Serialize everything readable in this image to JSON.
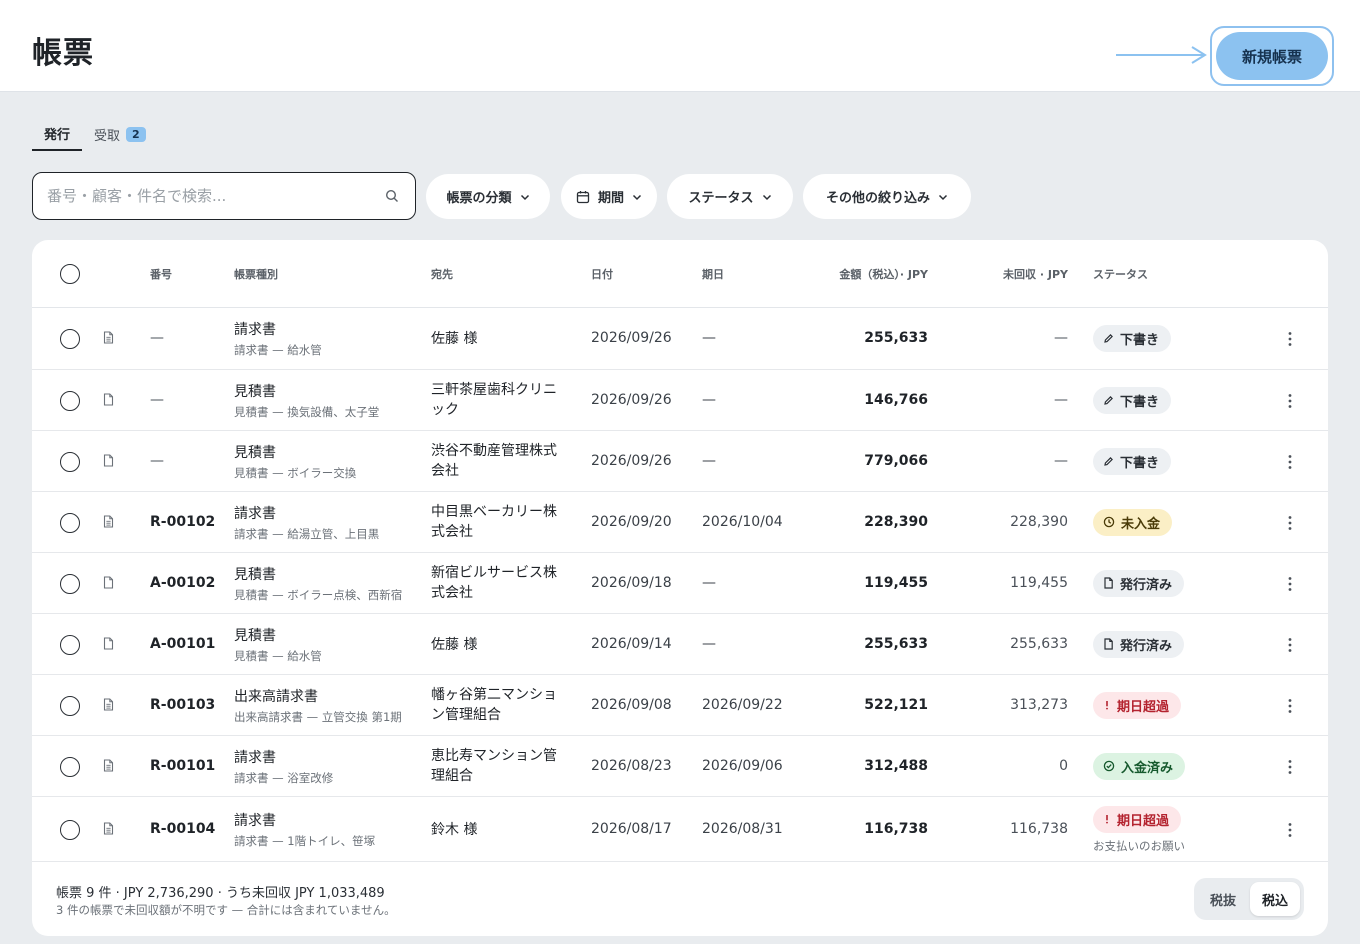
{
  "header": {
    "title": "帳票",
    "new_button": "新規帳票"
  },
  "tabs": [
    {
      "label": "発行",
      "active": true
    },
    {
      "label": "受取",
      "badge": "2"
    }
  ],
  "search": {
    "placeholder": "番号・顧客・件名で検索...",
    "value": ""
  },
  "filters": [
    {
      "label": "帳票の分類",
      "icon": "chevron-down-icon"
    },
    {
      "label": "期間",
      "icon": "calendar-icon"
    },
    {
      "label": "ステータス",
      "icon": "chevron-down-icon"
    },
    {
      "label": "その他の絞り込み",
      "icon": "chevron-down-icon"
    }
  ],
  "table": {
    "columns": [
      "番号",
      "帳票種別",
      "宛先",
      "日付",
      "期日",
      "金額（税込）· JPY",
      "未回収 · JPY",
      "ステータス"
    ],
    "rows": [
      {
        "number": "—",
        "type": "請求書",
        "subtitle": "請求書 — 給水管",
        "recipient": "佐藤 様",
        "date": "2026/09/26",
        "due": "—",
        "amount": "255,633",
        "unpaid": "—",
        "status": "下書き",
        "status_kind": "draft"
      },
      {
        "number": "—",
        "type": "見積書",
        "subtitle": "見積書 — 換気設備、太子堂",
        "recipient": "三軒茶屋歯科クリニック",
        "date": "2026/09/26",
        "due": "—",
        "amount": "146,766",
        "unpaid": "—",
        "status": "下書き",
        "status_kind": "draft"
      },
      {
        "number": "—",
        "type": "見積書",
        "subtitle": "見積書 — ボイラー交換",
        "recipient": "渋谷不動産管理株式会社",
        "date": "2026/09/26",
        "due": "—",
        "amount": "779,066",
        "unpaid": "—",
        "status": "下書き",
        "status_kind": "draft"
      },
      {
        "number": "R-00102",
        "type": "請求書",
        "subtitle": "請求書 — 給湯立管、上目黒",
        "recipient": "中目黒ベーカリー株式会社",
        "date": "2026/09/20",
        "due": "2026/10/04",
        "amount": "228,390",
        "unpaid": "228,390",
        "status": "未入金",
        "status_kind": "unpaid"
      },
      {
        "number": "A-00102",
        "type": "見積書",
        "subtitle": "見積書 — ボイラー点検、西新宿",
        "recipient": "新宿ビルサービス株式会社",
        "date": "2026/09/18",
        "due": "—",
        "amount": "119,455",
        "unpaid": "119,455",
        "status": "発行済み",
        "status_kind": "issued"
      },
      {
        "number": "A-00101",
        "type": "見積書",
        "subtitle": "見積書 — 給水管",
        "recipient": "佐藤 様",
        "date": "2026/09/14",
        "due": "—",
        "amount": "255,633",
        "unpaid": "255,633",
        "status": "発行済み",
        "status_kind": "issued"
      },
      {
        "number": "R-00103",
        "type": "出来高請求書",
        "subtitle": "出来高請求書 — 立管交換 第1期",
        "recipient": "幡ヶ谷第二マンション管理組合",
        "date": "2026/09/08",
        "due": "2026/09/22",
        "amount": "522,121",
        "unpaid": "313,273",
        "status": "期日超過",
        "status_kind": "overdue"
      },
      {
        "number": "R-00101",
        "type": "請求書",
        "subtitle": "請求書 — 浴室改修",
        "recipient": "恵比寿マンション管理組合",
        "date": "2026/08/23",
        "due": "2026/09/06",
        "amount": "312,488",
        "unpaid": "0",
        "status": "入金済み",
        "status_kind": "paid"
      },
      {
        "number": "R-00104",
        "type": "請求書",
        "subtitle": "請求書 — 1階トイレ、笹塚",
        "recipient": "鈴木 様",
        "date": "2026/08/17",
        "due": "2026/08/31",
        "amount": "116,738",
        "unpaid": "116,738",
        "status": "期日超過",
        "status_kind": "overdue",
        "status_note": "お支払いのお願い"
      }
    ]
  },
  "footer": {
    "summary": "帳票 9 件 · JPY 2,736,290 · うち未回収 JPY 1,033,489",
    "note": "3 件の帳票で未回収額が不明です — 合計には含まれていません。",
    "toggle": [
      "税抜",
      "税込"
    ],
    "toggle_selected": "税込"
  },
  "colors": {
    "accent": "#8cc2f0",
    "overdue": "#b4232f",
    "paid": "#16592d",
    "unpaid": "#fbefc6"
  }
}
